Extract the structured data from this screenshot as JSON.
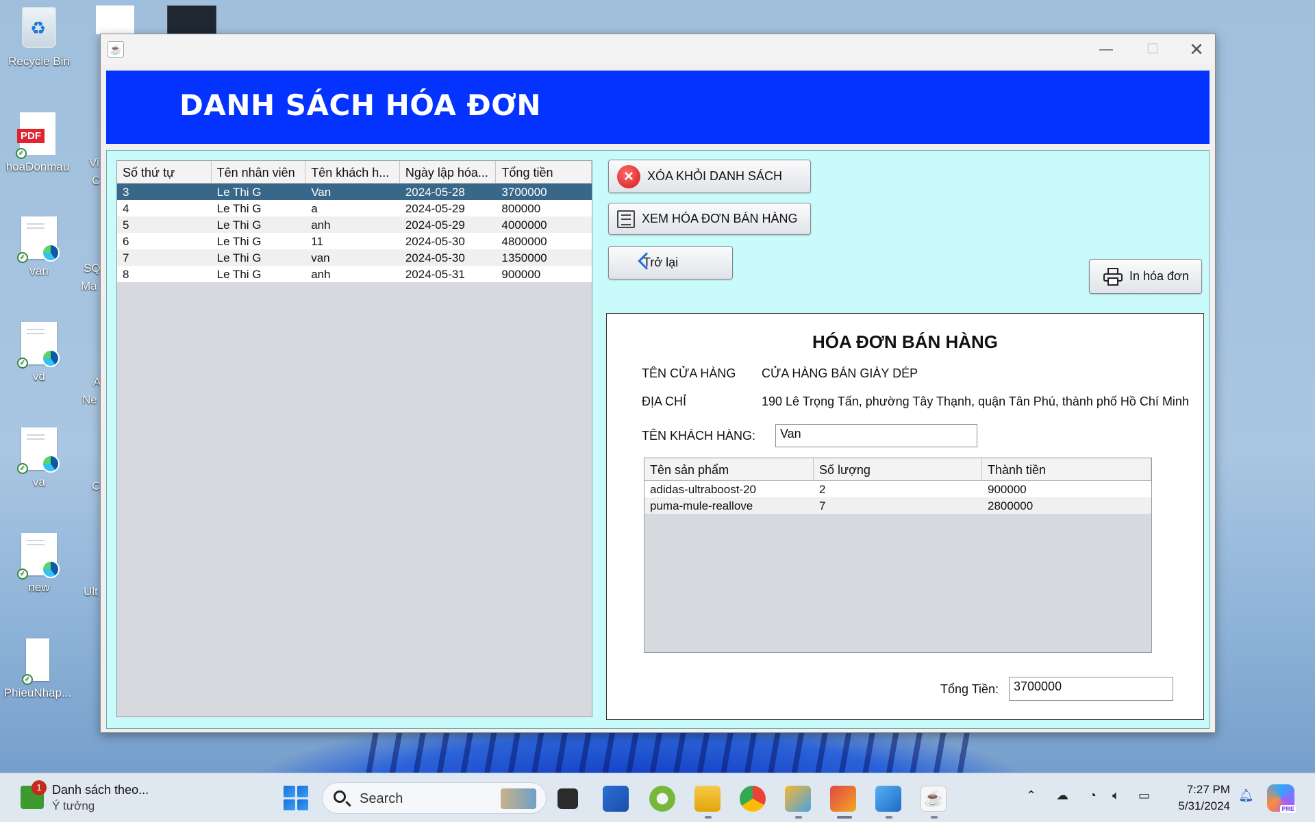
{
  "desktop": {
    "icons": [
      {
        "label": "Recycle Bin"
      },
      {
        "label": "hoaDonmau"
      },
      {
        "label": "van"
      },
      {
        "label": "vd"
      },
      {
        "label": "va"
      },
      {
        "label": "new"
      },
      {
        "label": "PhieuNhap..."
      }
    ],
    "pdf_badge": "PDF",
    "peek_labels": [
      "Vi",
      "C",
      "SQ",
      "Ma",
      "A",
      "Ne",
      "C",
      "Ult"
    ]
  },
  "window": {
    "title": "",
    "banner_title": "DANH SÁCH HÓA ĐƠN"
  },
  "invoice_list": {
    "columns": [
      "Số thứ tự",
      "Tên nhân viên",
      "Tên khách h...",
      "Ngày lập hóa...",
      "Tổng tiền"
    ],
    "rows": [
      [
        "3",
        "Le Thi G",
        "Van",
        "2024-05-28",
        "3700000"
      ],
      [
        "4",
        "Le Thi G",
        "a",
        "2024-05-29",
        "800000"
      ],
      [
        "5",
        "Le Thi G",
        "anh",
        "2024-05-29",
        "4000000"
      ],
      [
        "6",
        "Le Thi G",
        "11",
        "2024-05-30",
        "4800000"
      ],
      [
        "7",
        "Le Thi G",
        "van",
        "2024-05-30",
        "1350000"
      ],
      [
        "8",
        "Le Thi G",
        "anh",
        "2024-05-31",
        "900000"
      ]
    ],
    "selected_index": 0
  },
  "buttons": {
    "delete": "XÓA KHỎI DANH SÁCH",
    "view": "XEM HÓA ĐƠN BÁN HÀNG",
    "back": "Trở lại",
    "print": "In hóa đơn"
  },
  "invoice": {
    "title": "HÓA ĐƠN BÁN HÀNG",
    "store_label": "TÊN CỬA HÀNG",
    "store_value": "CỬA HÀNG BÁN GIÀY DÉP",
    "address_label": "ĐỊA CHỈ",
    "address_value": "190 Lê Trọng Tấn, phường Tây Thạnh, quận Tân Phú, thành phố Hồ Chí Minh",
    "customer_label": "TÊN KHÁCH HÀNG:",
    "customer_value": "Van",
    "product_columns": [
      "Tên sản phẩm",
      "Số lượng",
      "Thành tiền"
    ],
    "products": [
      [
        "adidas-ultraboost-20",
        "2",
        "900000"
      ],
      [
        "puma-mule-reallove",
        "7",
        "2800000"
      ]
    ],
    "total_label": "Tổng Tiền:",
    "total_value": "3700000"
  },
  "taskbar": {
    "notification_title": "Danh sách theo...",
    "notification_sub": "Ý tưởng",
    "notification_count": "1",
    "search_placeholder": "Search",
    "time": "7:27 PM",
    "date": "5/31/2024",
    "copilot_badge": "PRE"
  },
  "colors": {
    "banner": "#0433ff",
    "content_bg": "#c9fbfb",
    "selected_row": "#396789"
  }
}
